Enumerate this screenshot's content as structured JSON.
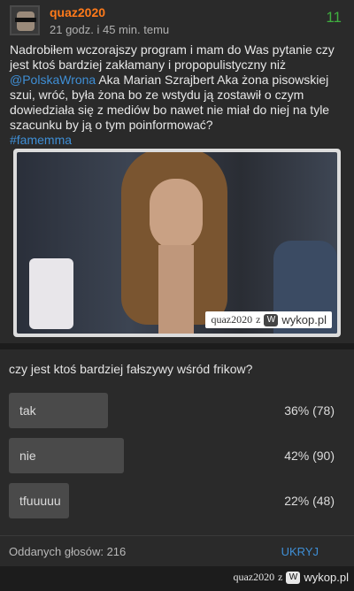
{
  "post": {
    "author": "quaz2020",
    "time": "21 godz. i 45 min. temu",
    "vote_count": "11",
    "body_before_mention": "Nadrobiłem wczorajszy program i mam do Was pytanie czy jest ktoś bardziej zakłamany i propopulistyczny niż ",
    "mention": "@PolskaWrona",
    "body_after_mention": " Aka Marian Szrajbert Aka żona pisowskiej szui, wróć, była żona bo ze wstydu ją zostawił o czym dowiedziała się z mediów bo nawet nie miał do niej na tyle szacunku by ją o tym poinformować?",
    "hashtag": "#famemma",
    "image_watermark": {
      "user": "quaz2020",
      "sep": "z",
      "site": "wykop.pl"
    }
  },
  "poll": {
    "question": "czy jest ktoś bardziej fałszywy wśród frikow?",
    "options": [
      {
        "label": "tak",
        "result": "36% (78)",
        "fraction": 0.36
      },
      {
        "label": "nie",
        "result": "42% (90)",
        "fraction": 0.42
      },
      {
        "label": "tfuuuuu",
        "result": "22% (48)",
        "fraction": 0.22
      }
    ],
    "total_votes": "Oddanych głosów: 216",
    "hide_label": "UKRYJ"
  },
  "footer_watermark": {
    "user": "quaz2020",
    "sep": "z",
    "site": "wykop.pl"
  }
}
